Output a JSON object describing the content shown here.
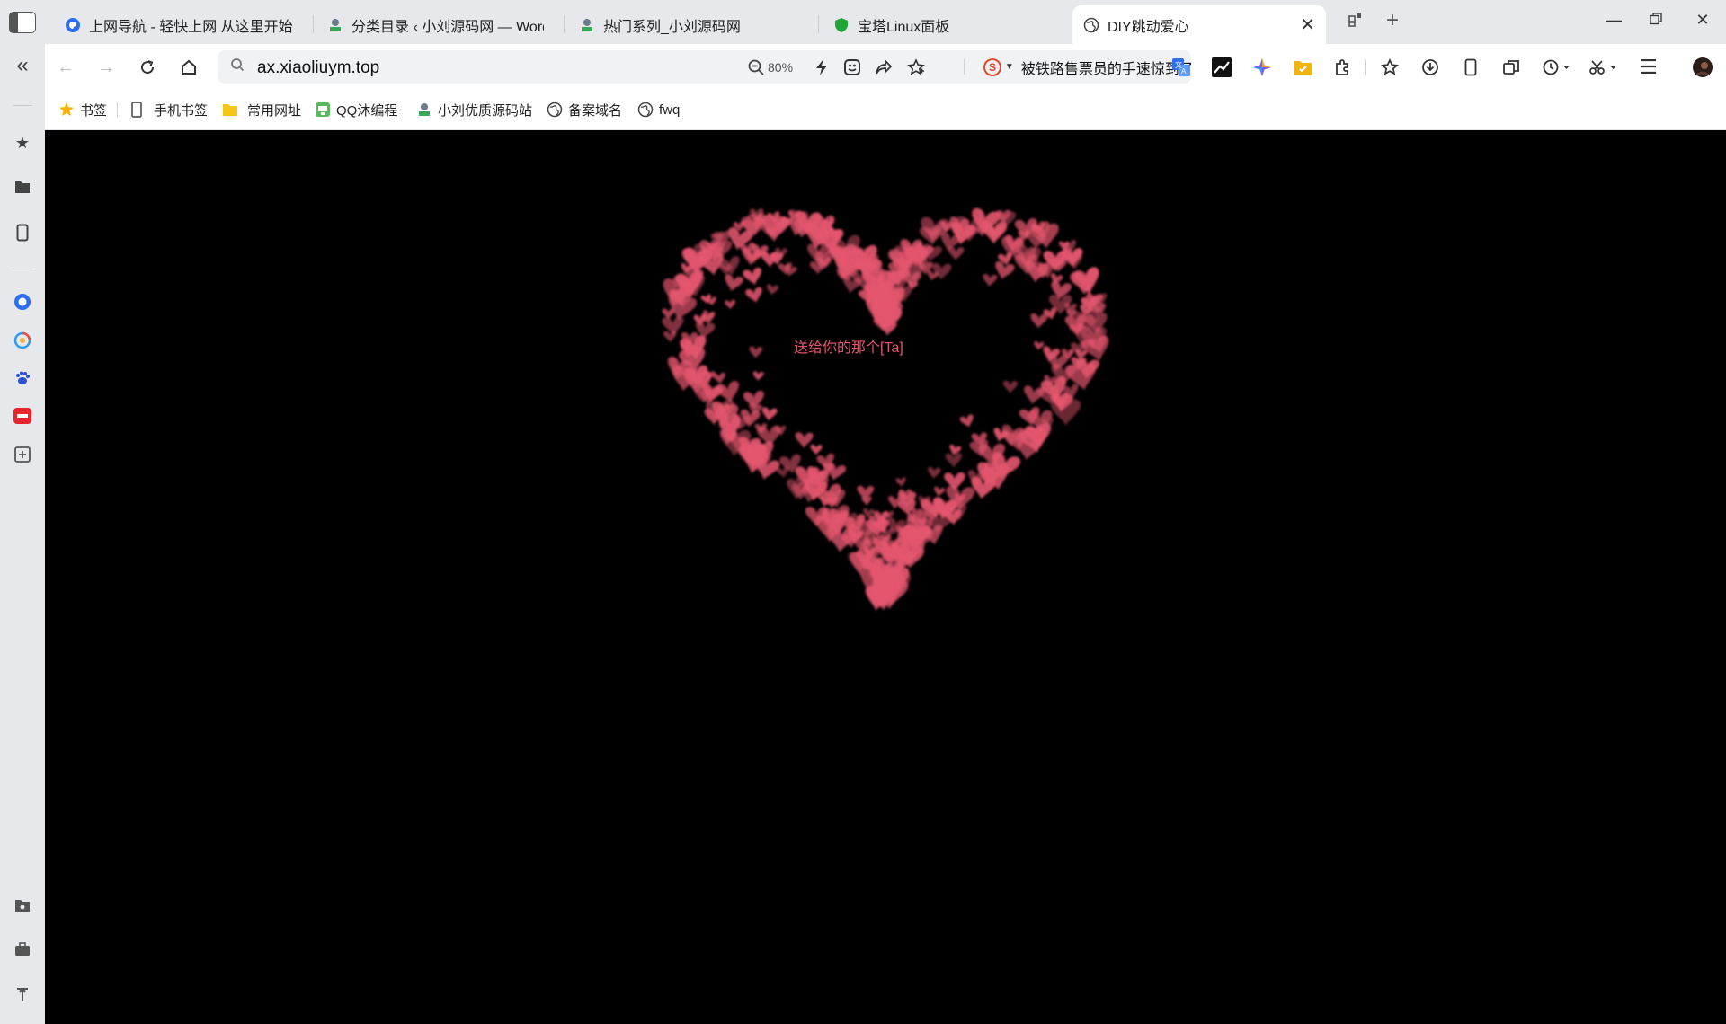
{
  "tabs": [
    {
      "title": "上网导航 - 轻快上网 从这里开始",
      "favicon": "q-logo-icon"
    },
    {
      "title": "分类目录 ‹ 小刘源码网 — Word",
      "favicon": "site-logo-icon"
    },
    {
      "title": "热门系列_小刘源码网",
      "favicon": "site-logo-icon"
    },
    {
      "title": "宝塔Linux面板",
      "favicon": "bt-shield-icon"
    },
    {
      "title": "DIY跳动爱心",
      "favicon": "globe-icon",
      "active": true
    }
  ],
  "address_bar": {
    "url": "ax.xiaoliuym.top",
    "zoom": "80%",
    "news_headline": "被铁路售票员的手速惊到了"
  },
  "bookmarks": [
    {
      "label": "书签",
      "icon": "star-icon"
    },
    {
      "label": "手机书签",
      "icon": "phone-icon"
    },
    {
      "label": "常用网址",
      "icon": "folder-icon"
    },
    {
      "label": "QQ沐编程",
      "icon": "site-logo-icon"
    },
    {
      "label": "小刘优质源码站",
      "icon": "site-logo-icon"
    },
    {
      "label": "备案域名",
      "icon": "globe-icon"
    },
    {
      "label": "fwq",
      "icon": "globe-icon"
    }
  ],
  "page": {
    "caption": "送给你的那个[Ta]",
    "background": "#000000",
    "heart_color": "#e4566e"
  },
  "colors": {
    "chrome_bg": "#e6e8ec",
    "toolbar_bg": "#ffffff",
    "heart_pink": "#e4566e"
  }
}
